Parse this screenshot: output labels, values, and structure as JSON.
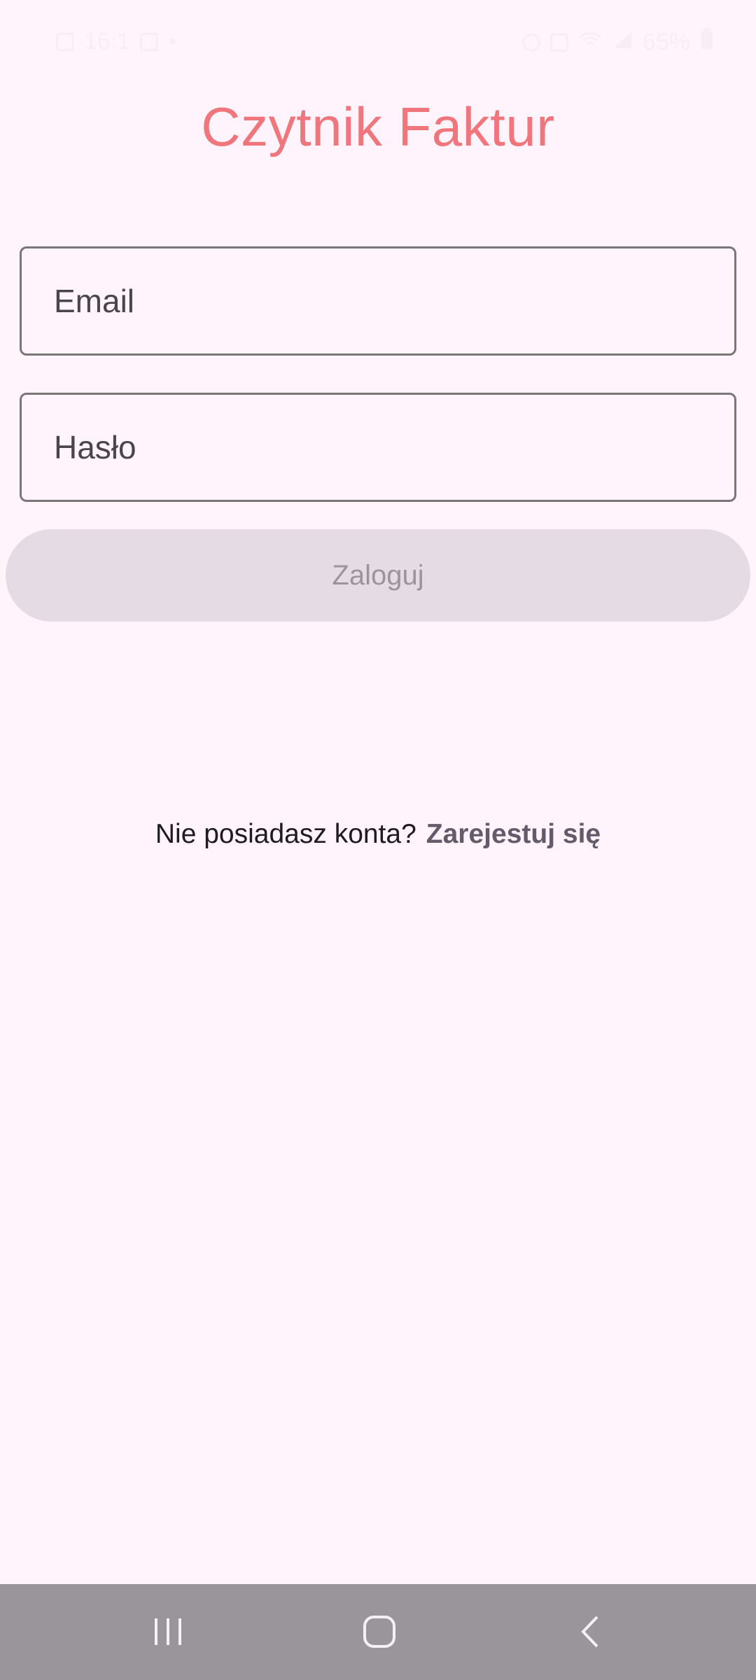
{
  "status_bar": {
    "time": "16:1",
    "left_icons": [
      "gallery-icon",
      "media-icon",
      "notification-dot-icon"
    ],
    "battery": "65%",
    "right_icons": [
      "alarm-icon",
      "mute-icon",
      "wifi-icon",
      "signal-icon",
      "battery-icon"
    ]
  },
  "app": {
    "title": "Czytnik Faktur"
  },
  "form": {
    "email_placeholder": "Email",
    "password_placeholder": "Hasło",
    "login_label": "Zaloguj"
  },
  "register": {
    "prompt": "Nie posiadasz konta?",
    "link_label": "Zarejestuj się"
  },
  "nav_bar": {
    "buttons": [
      "recents-icon",
      "home-icon",
      "back-icon"
    ]
  },
  "colors": {
    "background": "#fff4fb",
    "title": "#f0767d",
    "field_border": "#7a7577",
    "button_disabled_bg": "#e5dbe5",
    "button_disabled_text": "#9c949a",
    "link": "#635b69",
    "nav_bar": "#9a959a"
  }
}
